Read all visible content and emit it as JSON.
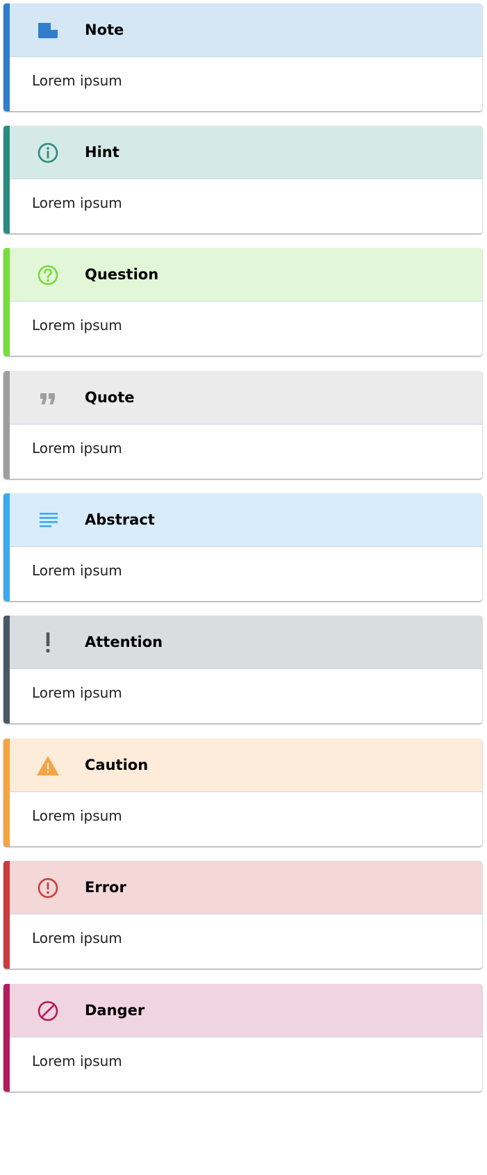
{
  "admonitions": [
    {
      "title": "Note",
      "body": "Lorem ipsum",
      "icon": "note-icon",
      "accent": "#2f7dcc",
      "header_bg": "#d5e6f5"
    },
    {
      "title": "Hint",
      "body": "Lorem ipsum",
      "icon": "info-icon",
      "accent": "#2b8a7e",
      "header_bg": "#d5eae6"
    },
    {
      "title": "Question",
      "body": "Lorem ipsum",
      "icon": "question-icon",
      "accent": "#76dd3a",
      "header_bg": "#e2f7d8"
    },
    {
      "title": "Quote",
      "body": "Lorem ipsum",
      "icon": "quote-icon",
      "accent": "#9e9e9e",
      "header_bg": "#ebebeb"
    },
    {
      "title": "Abstract",
      "body": "Lorem ipsum",
      "icon": "abstract-icon",
      "accent": "#3aa9f0",
      "header_bg": "#d8ecfb"
    },
    {
      "title": "Attention",
      "body": "Lorem ipsum",
      "icon": "attention-icon",
      "accent": "#4b5863",
      "header_bg": "#dadddf"
    },
    {
      "title": "Caution",
      "body": "Lorem ipsum",
      "icon": "warning-icon",
      "accent": "#f5a444",
      "header_bg": "#fdecd9"
    },
    {
      "title": "Error",
      "body": "Lorem ipsum",
      "icon": "error-icon",
      "accent": "#cc3a3d",
      "header_bg": "#f4d8d8"
    },
    {
      "title": "Danger",
      "body": "Lorem ipsum",
      "icon": "danger-icon",
      "accent": "#b51a5a",
      "header_bg": "#f0d4e0"
    }
  ]
}
